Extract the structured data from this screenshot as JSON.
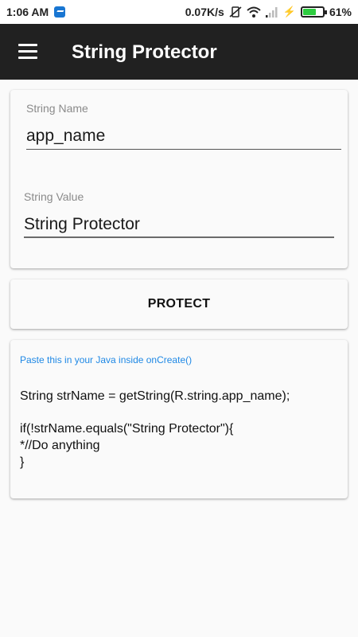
{
  "status_bar": {
    "time": "1:06 AM",
    "speed": "0.07K/s",
    "battery": "61%",
    "battery_level": 0.61,
    "icons": [
      "messenger-icon",
      "speed-indicator",
      "wifi-icon",
      "signal-icon",
      "charging-icon",
      "battery-icon"
    ]
  },
  "app_bar": {
    "title": "String Protector",
    "menu_icon": "hamburger-menu-icon"
  },
  "form": {
    "name_label": "String Name",
    "name_value": "app_name",
    "value_label": "String Value",
    "value_value": "String Protector"
  },
  "protect_button": {
    "label": "PROTECT"
  },
  "output": {
    "hint": "Paste this in your Java inside onCreate()",
    "lines": [
      "String strName = getString(R.string.app_name);",
      "",
      "if(!strName.equals(\"String Protector\"){",
      "*//Do anything",
      "}"
    ]
  },
  "colors": {
    "app_bar": "#212121",
    "accent_hint": "#1e88e5",
    "battery_fill": "#2ecc40"
  }
}
